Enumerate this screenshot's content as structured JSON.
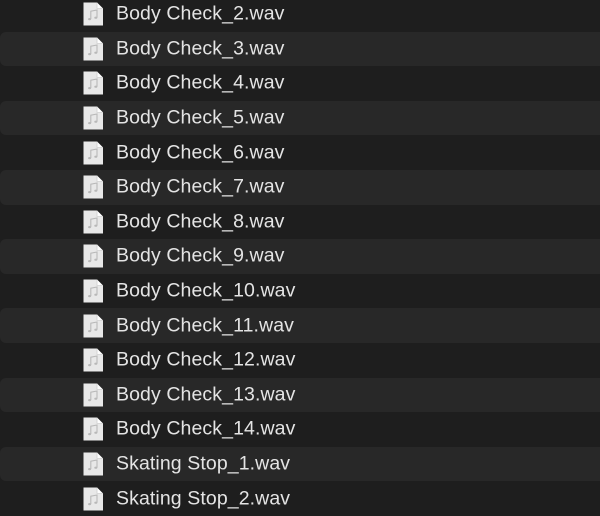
{
  "file_list": {
    "items": [
      {
        "name": "Body Check_2.wav",
        "icon": "audio-file-icon"
      },
      {
        "name": "Body Check_3.wav",
        "icon": "audio-file-icon"
      },
      {
        "name": "Body Check_4.wav",
        "icon": "audio-file-icon"
      },
      {
        "name": "Body Check_5.wav",
        "icon": "audio-file-icon"
      },
      {
        "name": "Body Check_6.wav",
        "icon": "audio-file-icon"
      },
      {
        "name": "Body Check_7.wav",
        "icon": "audio-file-icon"
      },
      {
        "name": "Body Check_8.wav",
        "icon": "audio-file-icon"
      },
      {
        "name": "Body Check_9.wav",
        "icon": "audio-file-icon"
      },
      {
        "name": "Body Check_10.wav",
        "icon": "audio-file-icon"
      },
      {
        "name": "Body Check_11.wav",
        "icon": "audio-file-icon"
      },
      {
        "name": "Body Check_12.wav",
        "icon": "audio-file-icon"
      },
      {
        "name": "Body Check_13.wav",
        "icon": "audio-file-icon"
      },
      {
        "name": "Body Check_14.wav",
        "icon": "audio-file-icon"
      },
      {
        "name": "Skating Stop_1.wav",
        "icon": "audio-file-icon"
      },
      {
        "name": "Skating Stop_2.wav",
        "icon": "audio-file-icon"
      }
    ]
  },
  "colors": {
    "background": "#1e1e1e",
    "stripe": "#282828",
    "text": "#e4e4e4",
    "icon_page": "#e8e8e8",
    "icon_note": "#b8b8b8"
  }
}
